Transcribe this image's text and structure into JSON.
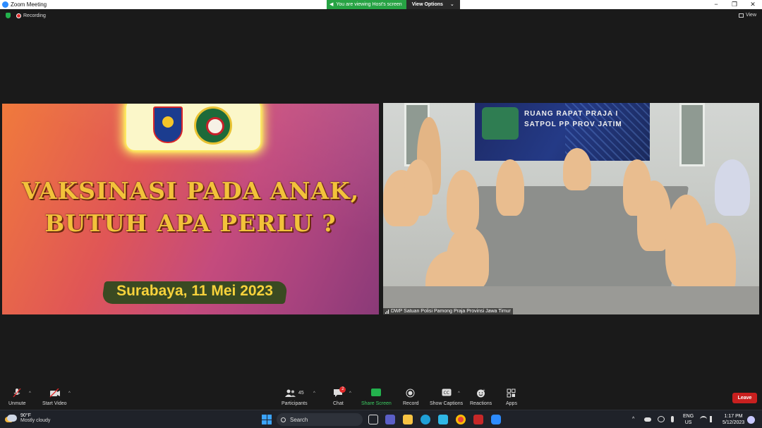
{
  "window": {
    "title": "Zoom Meeting",
    "controls": [
      "−",
      "❐",
      "✕"
    ]
  },
  "share_banner": {
    "viewing_text": "You are viewing Host's screen",
    "view_options": "View Options"
  },
  "meeting_status": {
    "recording": "Recording",
    "view_label": "View"
  },
  "shared_slide": {
    "title_line1": "VAKSINASI PADA ANAK,",
    "title_line2": "BUTUH APA PERLU ?",
    "place_date": "Surabaya, 11 Mei 2023"
  },
  "camera": {
    "banner_line1": "RUANG RAPAT PRAJA I",
    "banner_line2": "SATPOL PP PROV JATIM",
    "participant_name": "DWP Satuan Polisi Pamong Praja Provinsi Jawa Timur"
  },
  "toolbar": {
    "unmute": "Unmute",
    "start_video": "Start Video",
    "participants_count": "45",
    "participants": "Participants",
    "chat": "Chat",
    "chat_badge": "2",
    "share_screen": "Share Screen",
    "record": "Record",
    "show_captions": "Show Captions",
    "reactions": "Reactions",
    "apps": "Apps",
    "leave": "Leave"
  },
  "taskbar": {
    "temperature": "90°F",
    "weather": "Mostly cloudy",
    "search": "Search",
    "lang1": "ENG",
    "lang2": "US",
    "time": "1:17 PM",
    "date": "5/12/2023"
  },
  "colors": {
    "zoom_blue": "#2d8cff",
    "share_green": "#23b14d",
    "leave_red": "#c9201f",
    "slide_gold": "#f2c23a"
  }
}
